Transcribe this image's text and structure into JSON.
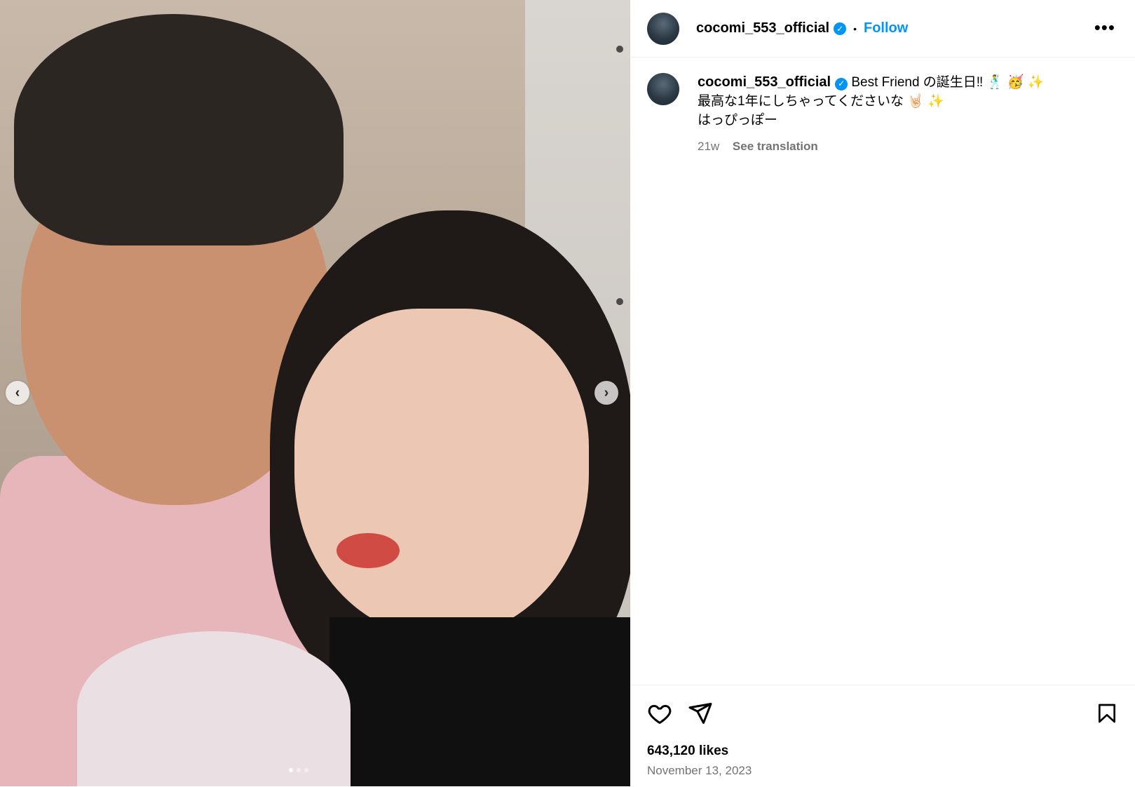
{
  "post": {
    "username": "cocomi_553_official",
    "verified": true,
    "separator": "•",
    "follow_label": "Follow",
    "more_label": "•••",
    "caption_lines": [
      "Best Friend の誕生日‼ 🕺 🥳 ✨",
      "最高な1年にしちゃってくださいな 🤘🏻 ✨",
      "はっぴっぽー"
    ],
    "age": "21w",
    "see_translation": "See translation",
    "likes": "643,120 likes",
    "date": "November 13, 2023"
  },
  "carousel": {
    "prev_icon": "chevron-left-icon",
    "next_icon": "chevron-right-icon",
    "prev_glyph": "‹",
    "next_glyph": "›"
  },
  "icons": {
    "like": "heart-icon",
    "share": "paper-plane-icon",
    "save": "bookmark-icon"
  },
  "colors": {
    "accent": "#0095f6",
    "muted": "#737373",
    "border": "#efefef"
  }
}
